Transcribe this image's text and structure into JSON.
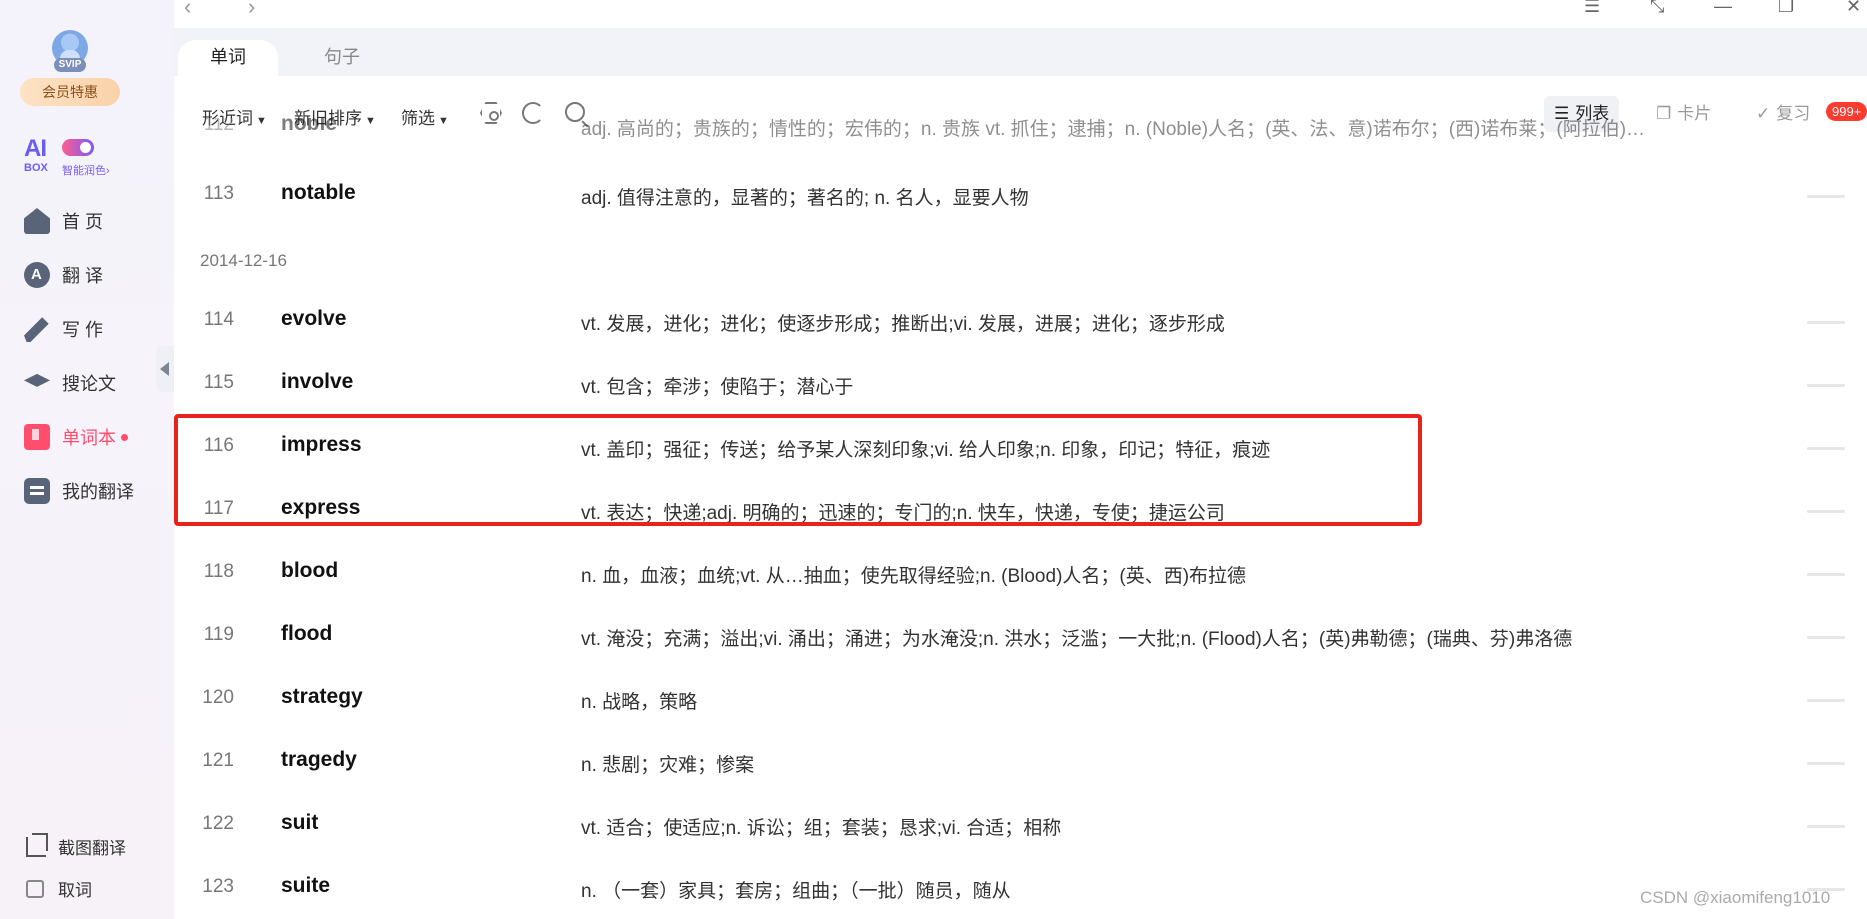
{
  "window": {
    "back": "‹",
    "forward": "›"
  },
  "sidebar": {
    "avatar_badge": "SVIP",
    "vip_label": "会员特惠",
    "aibox": {
      "ai": "AI",
      "box": "BOX",
      "tint": "智能润色›"
    },
    "items": [
      {
        "label": "首 页",
        "icon": "home-icon"
      },
      {
        "label": "翻 译",
        "icon": "translate-icon"
      },
      {
        "label": "写 作",
        "icon": "write-icon"
      },
      {
        "label": "搜论文",
        "icon": "graduation-cap-icon"
      },
      {
        "label": "单词本",
        "icon": "wordbook-icon",
        "active": true
      },
      {
        "label": "我的翻译",
        "icon": "my-translation-icon"
      }
    ],
    "bottom": [
      {
        "label": "截图翻译",
        "icon": "crop-icon"
      },
      {
        "label": "取词",
        "icon": "checkbox-icon"
      }
    ]
  },
  "tabs": [
    {
      "label": "单词",
      "active": true
    },
    {
      "label": "句子",
      "active": false
    }
  ],
  "toolbar": {
    "filter1": "形近词",
    "filter2": "新旧排序",
    "filter3": "筛选",
    "view_list": "列表",
    "view_card": "卡片",
    "view_review": "复习",
    "review_badge": "999+"
  },
  "list": {
    "partial_row": {
      "num": "112",
      "word": "noble",
      "def": "adj. 高尚的；贵族的；情性的；宏伟的；n. 贵族 vt. 抓住；逮捕；n. (Noble)人名；(英、法、意)诺布尔；(西)诺布莱；(阿拉伯)…"
    },
    "row113": {
      "num": "113",
      "word": "notable",
      "def": "adj. 值得注意的，显著的；著名的; n. 名人，显要人物"
    },
    "date": "2014-12-16",
    "rows": [
      {
        "num": "114",
        "word": "evolve",
        "def": "vt. 发展，进化；进化；使逐步形成；推断出;vi. 发展，进展；进化；逐步形成"
      },
      {
        "num": "115",
        "word": "involve",
        "def": "vt. 包含；牵涉；使陷于；潜心于"
      },
      {
        "num": "116",
        "word": "impress",
        "def": "vt. 盖印；强征；传送；给予某人深刻印象;vi. 给人印象;n. 印象，印记；特征，痕迹"
      },
      {
        "num": "117",
        "word": "express",
        "def": "vt. 表达；快递;adj. 明确的；迅速的；专门的;n. 快车，快递，专使；捷运公司"
      },
      {
        "num": "118",
        "word": "blood",
        "def": "n. 血，血液；血统;vt. 从…抽血；使先取得经验;n. (Blood)人名；(英、西)布拉德"
      },
      {
        "num": "119",
        "word": "flood",
        "def": "vt. 淹没；充满；溢出;vi. 涌出；涌进；为水淹没;n. 洪水；泛滥；一大批;n. (Flood)人名；(英)弗勒德；(瑞典、芬)弗洛德"
      },
      {
        "num": "120",
        "word": "strategy",
        "def": "n. 战略，策略"
      },
      {
        "num": "121",
        "word": "tragedy",
        "def": "n. 悲剧；灾难；惨案"
      },
      {
        "num": "122",
        "word": "suit",
        "def": "vt. 适合；使适应;n. 诉讼；组；套装；恳求;vi. 合适；相称"
      },
      {
        "num": "123",
        "word": "suite",
        "def": "n. （一套）家具；套房；组曲；（一批）随员，随从"
      }
    ]
  },
  "watermark": "CSDN @xiaomifeng1010"
}
